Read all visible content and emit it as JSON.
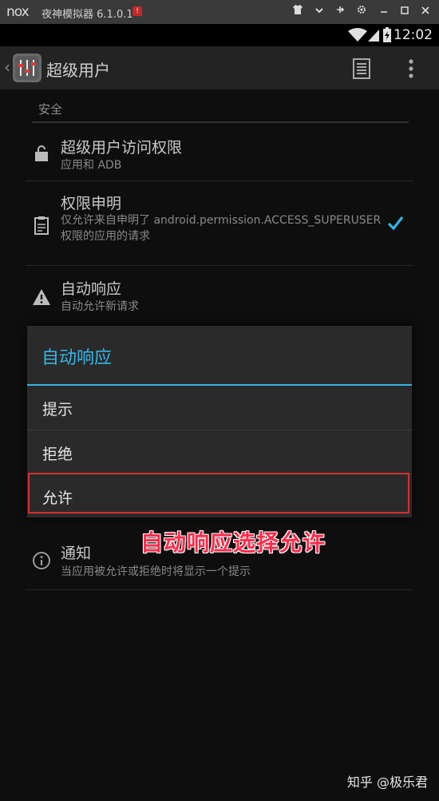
{
  "nox": {
    "logo": "nox",
    "title": "夜神模拟器 6.1.0.1",
    "badge": "!"
  },
  "status": {
    "time": "12:02"
  },
  "action_bar": {
    "title": "超级用户"
  },
  "settings": {
    "section_security": "安全",
    "items": [
      {
        "title": "超级用户访问权限",
        "summary": "应用和 ADB",
        "icon": "lock-icon"
      },
      {
        "title": "权限申明",
        "summary": "仅允许来自申明了 android.permission.ACCESS_SUPERUSER 权限的应用的请求",
        "icon": "clipboard-icon",
        "checked": true
      },
      {
        "title": "自动响应",
        "summary": "自动允许新请求",
        "icon": "warning-icon"
      },
      {
        "title": "通知",
        "summary": "当应用被允许或拒绝时将显示一个提示",
        "icon": "info-icon"
      }
    ]
  },
  "dialog": {
    "title": "自动响应",
    "options": [
      "提示",
      "拒绝",
      "允许"
    ],
    "highlighted_option": "允许"
  },
  "annotation": "自动响应选择允许",
  "watermark": "知乎 @极乐君",
  "colors": {
    "accent": "#33b5e5",
    "highlight": "#d32f2f",
    "annotation": "#ff2b4a"
  }
}
